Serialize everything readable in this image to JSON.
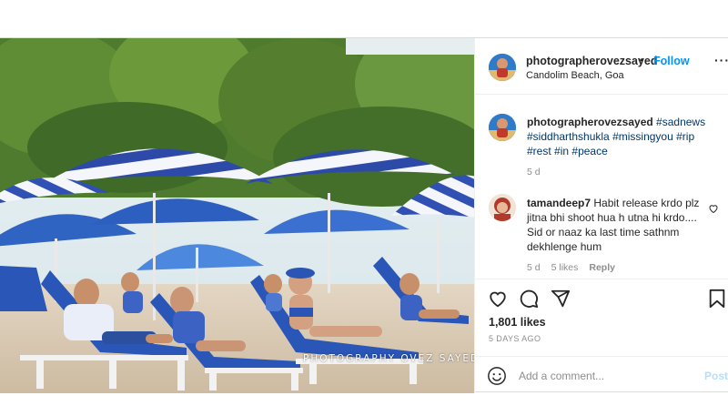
{
  "post": {
    "photo": {
      "watermark": "PHOTOGRAPHY OVEZ SAYED"
    },
    "header": {
      "username": "photographerovezsayed",
      "separator": "•",
      "follow_label": "Follow",
      "location": "Candolim Beach, Goa",
      "more_label": "···"
    },
    "caption": {
      "username": "photographerovezsayed",
      "hashtags": [
        "#sadnews",
        "#siddharthshukla",
        "#missingyou",
        "#rip",
        "#rest",
        "#in",
        "#peace"
      ],
      "age": "5 d"
    },
    "comment": {
      "username": "tamandeep7",
      "text": "Habit release krdo plz jitna bhi shoot hua h utna hi krdo.... Sid or naaz ka last time sathnm dekhlenge hum",
      "age": "5 d",
      "likes": "5 likes",
      "reply_label": "Reply"
    },
    "actions": {
      "icons": [
        "heart-icon",
        "comment-icon",
        "share-icon",
        "bookmark-icon"
      ],
      "likes": "1,801 likes",
      "time_ago": "5 DAYS AGO"
    },
    "add_comment": {
      "placeholder": "Add a comment...",
      "post_label": "Post"
    }
  },
  "colors": {
    "link": "#0095f6",
    "hashtag": "#00376b",
    "muted": "#8e8e8e",
    "post_disabled": "#b2dffc"
  }
}
